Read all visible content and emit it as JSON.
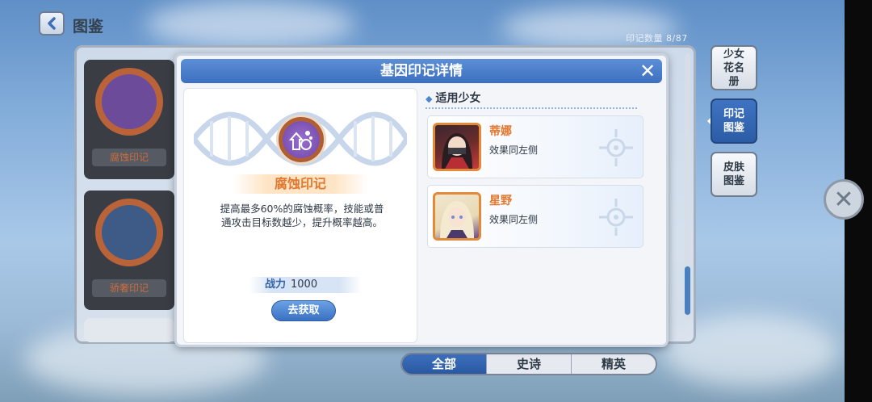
{
  "header": {
    "title": "图鉴",
    "mark_count": "印记数量 8/87"
  },
  "background_cards": [
    {
      "label": "腐蚀印记"
    },
    {
      "label": "骄奢印记"
    }
  ],
  "side_tabs": [
    {
      "label": "少女花名册",
      "active": false
    },
    {
      "label": "印记图鉴",
      "active": true
    },
    {
      "label": "皮肤图鉴",
      "active": false
    }
  ],
  "filters": [
    {
      "label": "全部",
      "active": true
    },
    {
      "label": "史诗",
      "active": false
    },
    {
      "label": "精英",
      "active": false
    }
  ],
  "modal": {
    "title": "基因印记详情",
    "mark": {
      "name": "腐蚀印记",
      "description": "提高最多60%的腐蚀概率，技能或普通攻击目标数越少，提升概率越高。",
      "power_label": "战力",
      "power_value": "1000",
      "acquire_label": "去获取"
    },
    "applicable": {
      "heading": "适用少女",
      "girls": [
        {
          "name": "蒂娜",
          "effect": "效果同左侧"
        },
        {
          "name": "星野",
          "effect": "效果同左侧"
        }
      ]
    }
  },
  "colors": {
    "accent_blue": "#3c6fbf",
    "mark_orange": "#e2772f"
  }
}
